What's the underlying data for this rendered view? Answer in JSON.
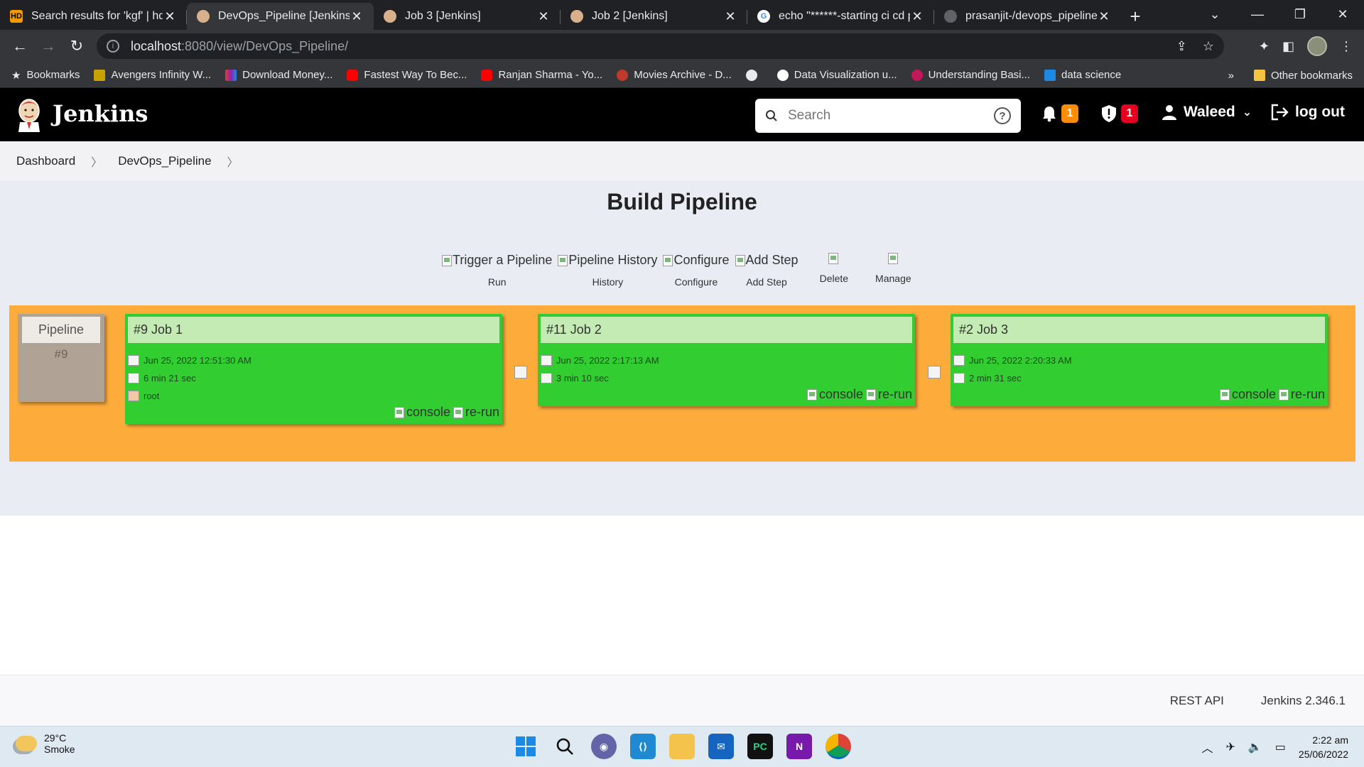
{
  "browser": {
    "tabs": [
      {
        "title": "Search results for 'kgf' | hdt",
        "favicon": "hd-icon",
        "active": false
      },
      {
        "title": "DevOps_Pipeline [Jenkins]",
        "favicon": "jenkins-icon",
        "active": true
      },
      {
        "title": "Job 3 [Jenkins]",
        "favicon": "jenkins-icon",
        "active": false
      },
      {
        "title": "Job 2 [Jenkins]",
        "favicon": "jenkins-icon",
        "active": false
      },
      {
        "title": "echo \"******-starting ci cd p",
        "favicon": "google-icon",
        "active": false
      },
      {
        "title": "prasanjit-/devops_pipeline",
        "favicon": "github-icon",
        "active": false
      }
    ],
    "url_host": "localhost",
    "url_path": ":8080/view/DevOps_Pipeline/",
    "bookmarks": [
      {
        "label": "Bookmarks",
        "icon": "star-icon"
      },
      {
        "label": "Avengers Infinity W...",
        "icon": "bookmark-icon"
      },
      {
        "label": "Download Money...",
        "icon": "bookmark-icon"
      },
      {
        "label": "Fastest Way To Bec...",
        "icon": "youtube-icon"
      },
      {
        "label": "Ranjan Sharma - Yo...",
        "icon": "youtube-icon"
      },
      {
        "label": "Movies Archive - D...",
        "icon": "bookmark-icon"
      },
      {
        "label": "",
        "icon": "globe-icon"
      },
      {
        "label": "Data Visualization u...",
        "icon": "google-icon"
      },
      {
        "label": "Understanding Basi...",
        "icon": "bookmark-icon"
      },
      {
        "label": "data science",
        "icon": "bookmark-icon"
      }
    ],
    "more_bookmarks": "»",
    "other_bookmarks": "Other bookmarks"
  },
  "jenkins": {
    "brand": "Jenkins",
    "search_placeholder": "Search",
    "notifications_count": "1",
    "security_count": "1",
    "user_name": "Waleed",
    "logout_label": "log out"
  },
  "breadcrumb": [
    "Dashboard",
    "DevOps_Pipeline"
  ],
  "page": {
    "title": "Build Pipeline",
    "actions": [
      {
        "alt": "Trigger a Pipeline",
        "label": "Run"
      },
      {
        "alt": "Pipeline History",
        "label": "History"
      },
      {
        "alt": "Configure",
        "label": "Configure"
      },
      {
        "alt": "Add Step",
        "label": "Add Step"
      },
      {
        "alt": "",
        "label": "Delete"
      },
      {
        "alt": "",
        "label": "Manage"
      }
    ]
  },
  "pipeline": {
    "label": "Pipeline",
    "number": "#9",
    "jobs": [
      {
        "title": "#9 Job 1",
        "date": "Jun 25, 2022 12:51:30 AM",
        "duration": "6 min 21 sec",
        "user": "root",
        "console": "console",
        "rerun": "re-run",
        "status_color": "#31cd31"
      },
      {
        "title": "#11 Job 2",
        "date": "Jun 25, 2022 2:17:13 AM",
        "duration": "3 min 10 sec",
        "user": "",
        "console": "console",
        "rerun": "re-run",
        "status_color": "#31cd31"
      },
      {
        "title": "#2 Job 3",
        "date": "Jun 25, 2022 2:20:33 AM",
        "duration": "2 min 31 sec",
        "user": "",
        "console": "console",
        "rerun": "re-run",
        "status_color": "#31cd31"
      }
    ]
  },
  "footer": {
    "rest_api": "REST API",
    "version": "Jenkins 2.346.1"
  },
  "taskbar": {
    "temperature": "29°C",
    "weather": "Smoke",
    "time": "2:22 am",
    "date": "25/06/2022"
  }
}
